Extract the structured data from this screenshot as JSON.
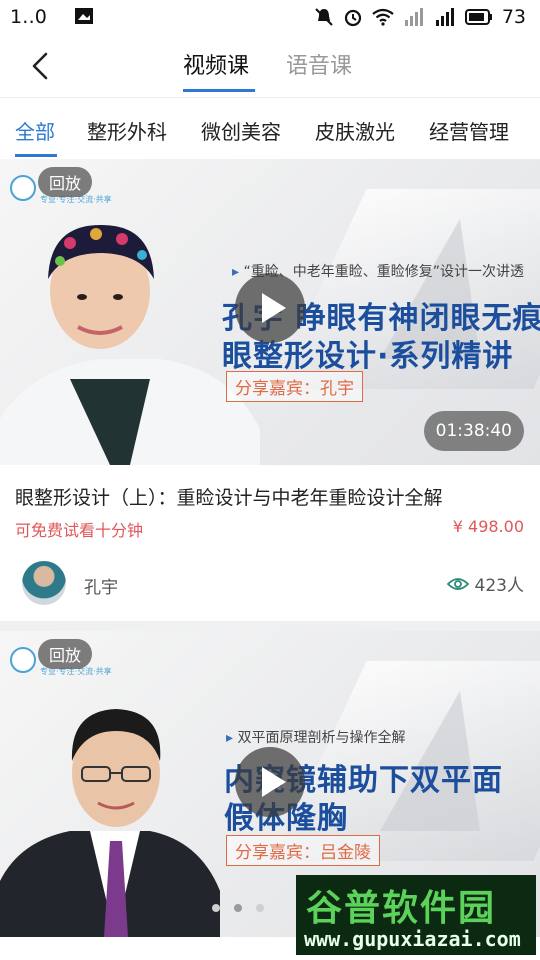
{
  "status_bar": {
    "time": "1‥0",
    "battery": "73"
  },
  "header": {
    "tabs": [
      {
        "label": "视频课",
        "active": true
      },
      {
        "label": "语音课",
        "active": false
      }
    ]
  },
  "categories": [
    "全部",
    "整形外科",
    "微创美容",
    "皮肤激光",
    "经营管理"
  ],
  "courses": [
    {
      "replay_badge": "回放",
      "banner_subtitle": "“重睑、中老年重睑、重睑修复”设计一次讲透",
      "banner_title_line1": "孔宇 睁眼有神闭眼无痕",
      "banner_title_line2": "眼整形设计·系列精讲",
      "banner_guest": "分享嘉宾：孔宇",
      "duration": "01:38:40",
      "title": "眼整形设计（上）：重睑设计与中老年重睑设计全解",
      "trial": "可免费试看十分钟",
      "price": "¥ 498.00",
      "teacher": "孔宇",
      "views": "423人"
    },
    {
      "replay_badge": "回放",
      "banner_subtitle": "双平面原理剖析与操作全解",
      "banner_title_line1": "内窥镜辅助下双平面",
      "banner_title_line2": "假体隆胸",
      "banner_guest": "分享嘉宾：吕金陵"
    }
  ],
  "watermark": {
    "top": "谷普软件园",
    "bottom": "www.gupuxiazai.com"
  },
  "colors": {
    "accent": "#2d79d4",
    "price": "#e0575a",
    "banner_title": "#1c4e9e",
    "guest": "#e06a45"
  },
  "icons": [
    "back-icon",
    "play-icon",
    "eye-icon",
    "mute-icon",
    "alarm-icon",
    "wifi-icon",
    "signal-icon",
    "battery-icon"
  ]
}
